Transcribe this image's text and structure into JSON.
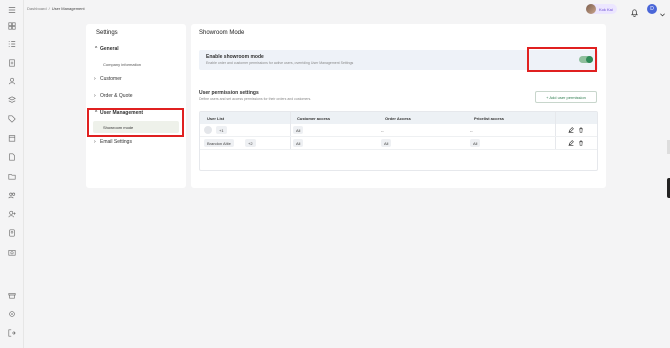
{
  "breadcrumb": {
    "root": "Dashboard",
    "separator": "/",
    "current": "User Management"
  },
  "user": {
    "name": "Kok Kai",
    "org_initial": "D"
  },
  "rail_icons": [
    "menu-icon",
    "dashboard-icon",
    "list-icon",
    "document-icon",
    "receipt-icon",
    "user-icon",
    "layers-icon",
    "tag-icon",
    "calendar-icon",
    "file-icon",
    "folder-icon",
    "team-icon",
    "user-add-icon",
    "badge-icon",
    "camera-icon",
    "store-icon",
    "settings-icon",
    "logout-icon"
  ],
  "settings": {
    "title": "Settings",
    "nav": [
      {
        "label": "General",
        "expanded": true,
        "children": [
          "Company information"
        ]
      },
      {
        "label": "Customer",
        "expanded": false
      },
      {
        "label": "Order & Quote",
        "expanded": false
      },
      {
        "label": "User Management",
        "expanded": true,
        "children": [
          "Showroom mode"
        ]
      },
      {
        "label": "Email Settings",
        "expanded": false
      }
    ]
  },
  "main": {
    "title": "Showroom Mode",
    "showroom": {
      "label": "Enable showroom mode",
      "description": "Enable order and customer permissions for active users, overriding User Management Settings",
      "enabled": true
    },
    "permissions": {
      "title": "User permission settings",
      "description": "Define users and set access permissions for their orders and customers.",
      "add_button": "+ Add user permission",
      "columns": [
        "User List",
        "Customer access",
        "Order Access",
        "Pricelist access"
      ],
      "rows": [
        {
          "user": "",
          "extra": "+1",
          "customer": "All",
          "order": "--",
          "pricelist": "--"
        },
        {
          "user": "Brandon Altie",
          "extra": "+2",
          "customer": "All",
          "order": "All",
          "pricelist": "All"
        }
      ]
    }
  },
  "colors": {
    "accent": "#2e8b57",
    "highlight": "#e02020",
    "brand": "#4a66d8"
  }
}
